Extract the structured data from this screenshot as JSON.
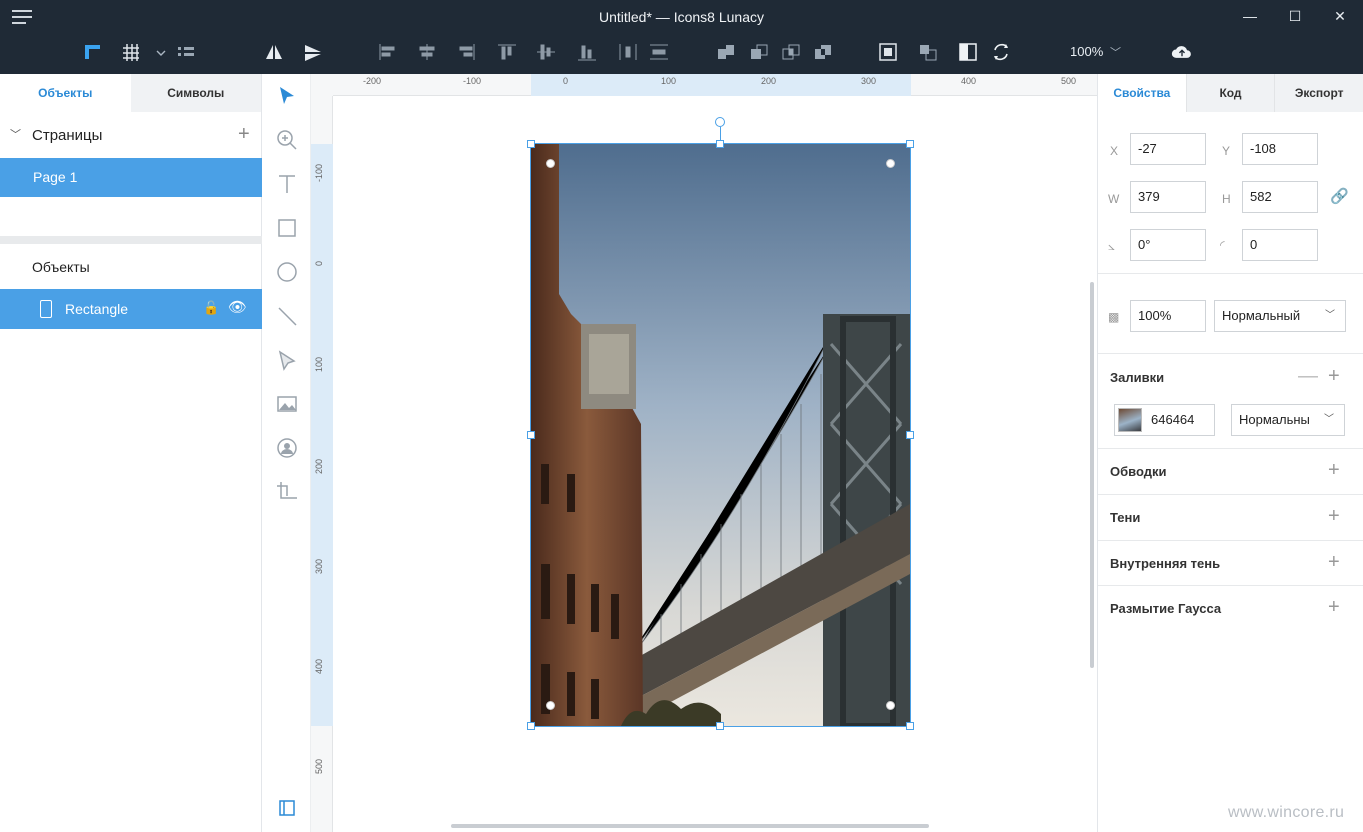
{
  "window": {
    "title": "Untitled* — Icons8 Lunacy",
    "controls": [
      "minimize-icon",
      "maximize-icon",
      "close-icon"
    ]
  },
  "toolbar": {
    "zoom": "100%",
    "icons": [
      "ruler-icon",
      "grid-icon",
      "layout-grid-icon",
      "flip-horizontal-icon",
      "flip-vertical-icon",
      "align-left-icon",
      "align-center-icon",
      "align-right-icon",
      "align-top-icon",
      "align-middle-icon",
      "align-bottom-icon",
      "distribute-horizontal-icon",
      "distribute-vertical-icon",
      "union-icon",
      "subtract-icon",
      "intersect-icon",
      "difference-icon",
      "mask-icon",
      "group-icon",
      "invert-icon",
      "refresh-icon",
      "cloud-upload-icon"
    ]
  },
  "left_panel": {
    "tabs": [
      {
        "label": "Объекты"
      },
      {
        "label": "Символы"
      }
    ],
    "pages_label": "Страницы",
    "pages": [
      {
        "label": "Page 1"
      }
    ],
    "objects_label": "Объекты",
    "layers": [
      {
        "label": "Rectangle"
      }
    ]
  },
  "tools": [
    "select-icon",
    "zoom-icon",
    "text-icon",
    "rectangle-icon",
    "ellipse-icon",
    "line-icon",
    "pen-icon",
    "image-icon",
    "avatar-icon",
    "crop-icon",
    "panel-toggle-icon"
  ],
  "rulers": {
    "horizontal": [
      "-200",
      "-100",
      "0",
      "100",
      "200",
      "300",
      "400",
      "500"
    ],
    "vertical": [
      "-100",
      "0",
      "100",
      "200",
      "300",
      "400",
      "500"
    ]
  },
  "right_panel": {
    "tabs": [
      {
        "label": "Свойства"
      },
      {
        "label": "Код"
      },
      {
        "label": "Экспорт"
      }
    ],
    "x_label": "X",
    "x": "-27",
    "y_label": "Y",
    "y": "-108",
    "w_label": "W",
    "w": "379",
    "h_label": "H",
    "h": "582",
    "angle": "0°",
    "radius": "0",
    "opacity": "100%",
    "blend": "Нормальный",
    "fills_label": "Заливки",
    "fill_color": "646464",
    "fill_blend": "Нормальны",
    "borders_label": "Обводки",
    "shadows_label": "Тени",
    "inner_shadow_label": "Внутренняя тень",
    "blur_label": "Размытие Гаусса"
  },
  "watermark": "www.wincore.ru",
  "colors": {
    "accent": "#4aa0e6",
    "titlebar": "#1f2a36"
  }
}
